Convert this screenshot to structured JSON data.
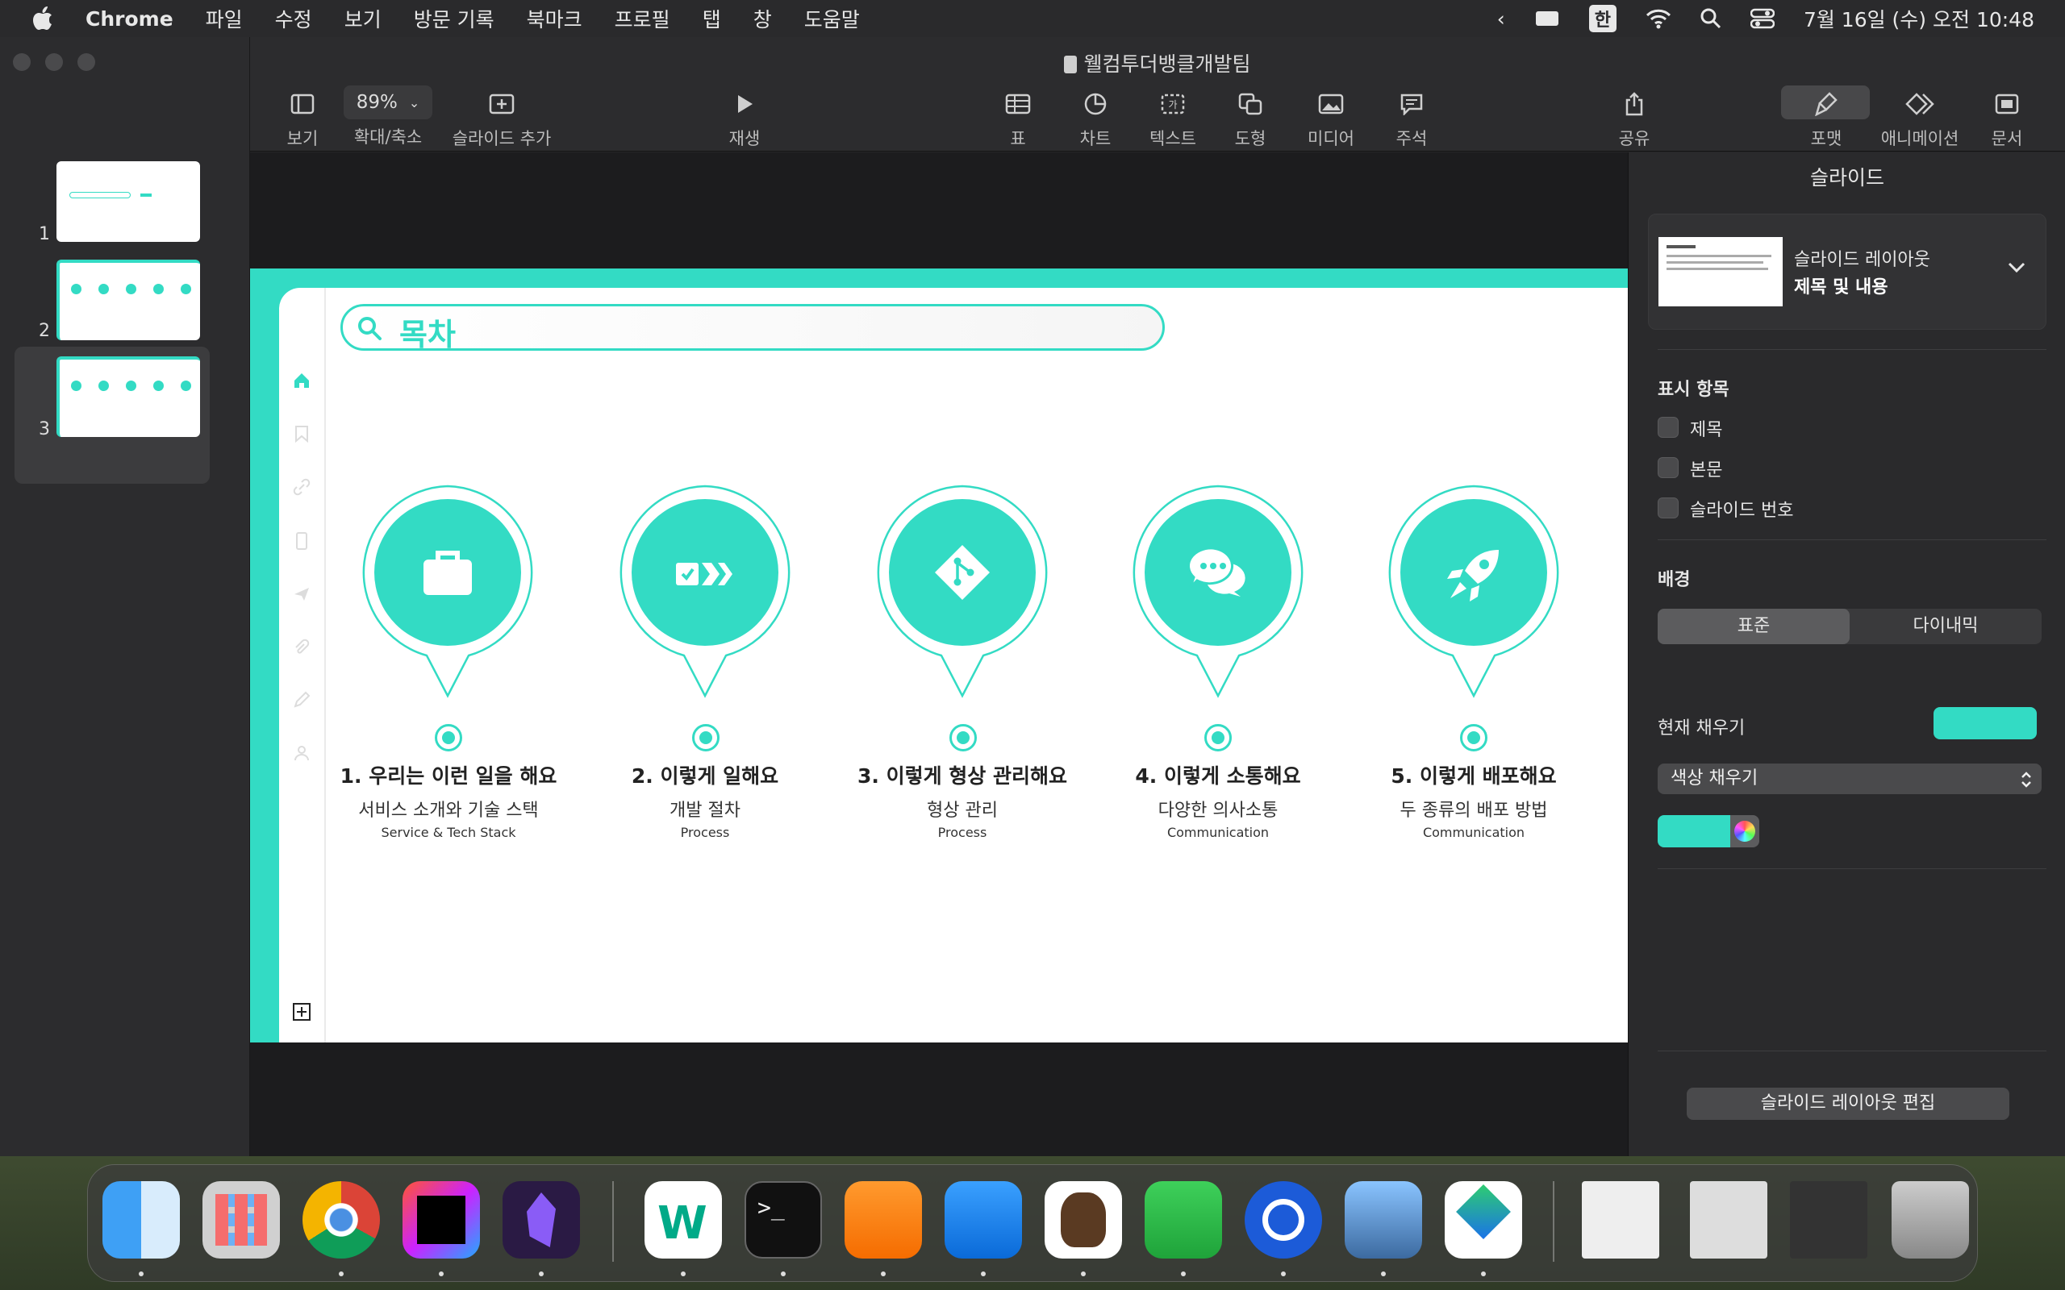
{
  "menubar": {
    "app": "Chrome",
    "items": [
      "파일",
      "수정",
      "보기",
      "방문 기록",
      "북마크",
      "프로필",
      "탭",
      "창",
      "도움말"
    ],
    "input_mode": "한",
    "clock": "7월 16일 (수) 오전 10:48"
  },
  "document": {
    "title": "웰컴투더뱅클개발팀"
  },
  "toolbar": {
    "view": "보기",
    "zoom_value": "89%",
    "zoom_label": "확대/축소",
    "add_slide": "슬라이드 추가",
    "play": "재생",
    "table": "표",
    "chart": "차트",
    "text": "텍스트",
    "shape": "도형",
    "media": "미디어",
    "comment": "주석",
    "share": "공유",
    "format": "포맷",
    "animate": "애니메이션",
    "document": "문서"
  },
  "slides_nav": {
    "numbers": [
      "1",
      "2",
      "3"
    ],
    "selected": "3"
  },
  "slide": {
    "search_text": "목차",
    "accent": "#33dbc4",
    "sections": [
      {
        "title": "1. 우리는 이런 일을 해요",
        "subtitle": "서비스 소개와 기술 스택",
        "english": "Service & Tech Stack",
        "icon": "briefcase-icon"
      },
      {
        "title": "2. 이렇게 일해요",
        "subtitle": "개발 절차",
        "english": "Process",
        "icon": "process-arrows-icon"
      },
      {
        "title": "3. 이렇게 형상 관리해요",
        "subtitle": "형상 관리",
        "english": "Process",
        "icon": "git-icon"
      },
      {
        "title": "4. 이렇게 소통해요",
        "subtitle": "다양한 의사소통",
        "english": "Communication",
        "icon": "chat-bubbles-icon"
      },
      {
        "title": "5. 이렇게 배포해요",
        "subtitle": "두 종류의 배포 방법",
        "english": "Communication",
        "icon": "rocket-icon"
      }
    ]
  },
  "inspector": {
    "title": "슬라이드",
    "layout_label": "슬라이드 레이아웃",
    "layout_value": "제목 및 내용",
    "show_label": "표시 항목",
    "checks": [
      "제목",
      "본문",
      "슬라이드 번호"
    ],
    "background_label": "배경",
    "seg_standard": "표준",
    "seg_dynamic": "다이내믹",
    "current_fill_label": "현재 채우기",
    "fill_type": "색상 채우기",
    "edit_layout": "슬라이드 레이아웃 편집"
  },
  "dock": {
    "apps": [
      "Finder",
      "Launchpad",
      "Chrome",
      "IntelliJ IDEA",
      "Obsidian",
      "Naver Whale",
      "Terminal",
      "Pages",
      "Keynote",
      "DBeaver CE",
      "Numbers",
      "Sourcetree",
      "Preview",
      "Naver",
      "Document",
      "Screenshot",
      "Folder",
      "Trash"
    ]
  }
}
